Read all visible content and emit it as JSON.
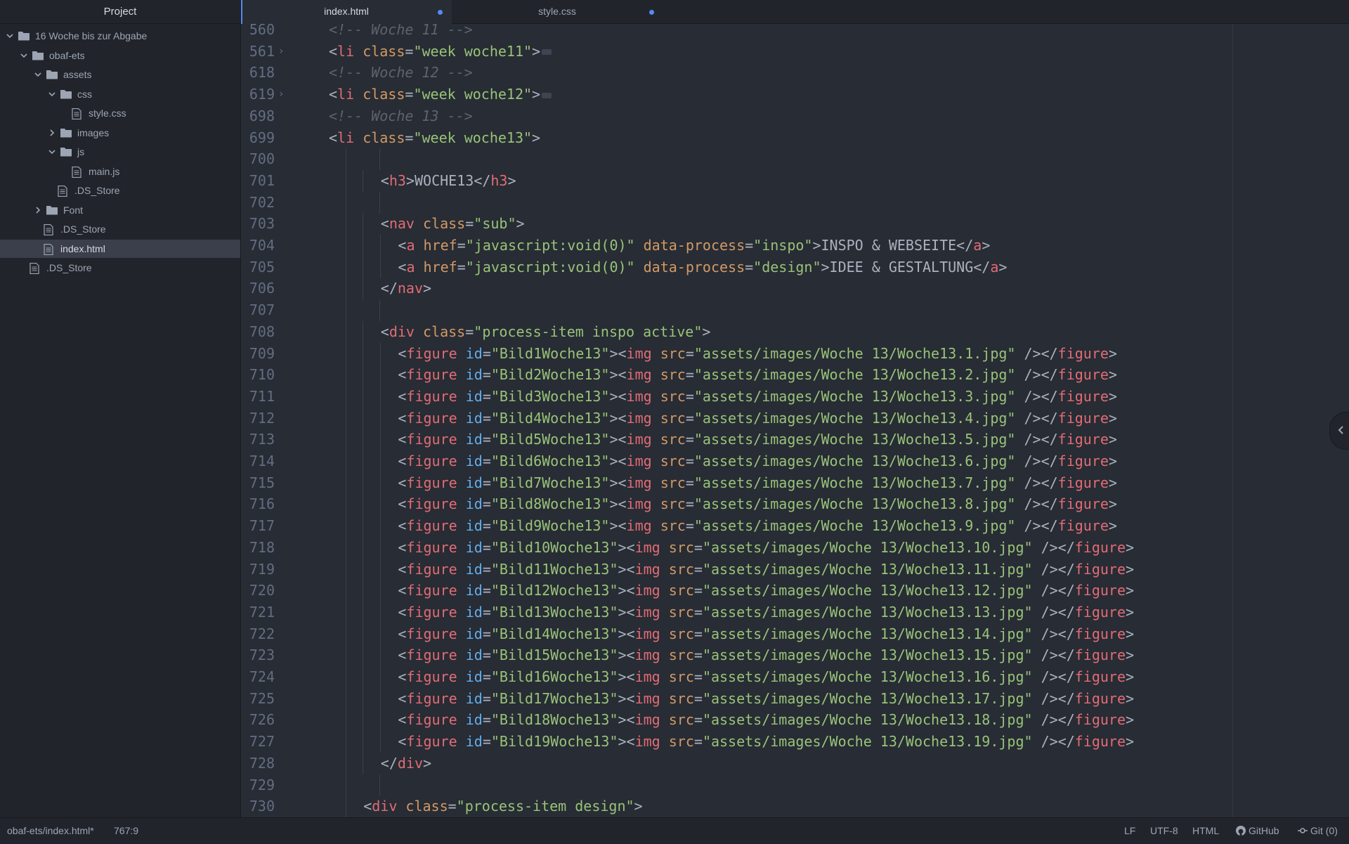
{
  "sidebar": {
    "title": "Project",
    "tree": [
      {
        "label": "16 Woche bis zur Abgabe",
        "type": "folder",
        "expanded": true,
        "depth": 0
      },
      {
        "label": "obaf-ets",
        "type": "folder",
        "expanded": true,
        "depth": 1
      },
      {
        "label": "assets",
        "type": "folder",
        "expanded": true,
        "depth": 2
      },
      {
        "label": "css",
        "type": "folder",
        "expanded": true,
        "depth": 3
      },
      {
        "label": "style.css",
        "type": "file",
        "depth": 4
      },
      {
        "label": "images",
        "type": "folder",
        "expanded": false,
        "depth": 3
      },
      {
        "label": "js",
        "type": "folder",
        "expanded": true,
        "depth": 3
      },
      {
        "label": "main.js",
        "type": "file",
        "depth": 4
      },
      {
        "label": ".DS_Store",
        "type": "file",
        "depth": 3
      },
      {
        "label": "Font",
        "type": "folder",
        "expanded": false,
        "depth": 2
      },
      {
        "label": ".DS_Store",
        "type": "file",
        "depth": 2
      },
      {
        "label": "index.html",
        "type": "file",
        "depth": 2,
        "selected": true
      },
      {
        "label": ".DS_Store",
        "type": "file",
        "depth": 1
      }
    ]
  },
  "tabs": [
    {
      "label": "index.html",
      "active": true,
      "modified": true
    },
    {
      "label": "style.css",
      "active": false,
      "modified": true
    }
  ],
  "editor": {
    "lines": [
      {
        "n": "560",
        "indent": 0,
        "segs": [
          [
            "com",
            "<!-- Woche 11 -->"
          ]
        ]
      },
      {
        "n": "561",
        "indent": 0,
        "fold": true,
        "segs": [
          [
            "punct",
            "<"
          ],
          [
            "tag",
            "li"
          ],
          [
            "punct",
            " "
          ],
          [
            "attr",
            "class"
          ],
          [
            "punct",
            "="
          ],
          [
            "str",
            "\"week woche11\""
          ],
          [
            "punct",
            ">"
          ]
        ],
        "collapsed": true
      },
      {
        "n": "618",
        "indent": 0,
        "segs": [
          [
            "com",
            "<!-- Woche 12 -->"
          ]
        ]
      },
      {
        "n": "619",
        "indent": 0,
        "fold": true,
        "segs": [
          [
            "punct",
            "<"
          ],
          [
            "tag",
            "li"
          ],
          [
            "punct",
            " "
          ],
          [
            "attr",
            "class"
          ],
          [
            "punct",
            "="
          ],
          [
            "str",
            "\"week woche12\""
          ],
          [
            "punct",
            ">"
          ]
        ],
        "collapsed": true
      },
      {
        "n": "698",
        "indent": 0,
        "segs": [
          [
            "com",
            "<!-- Woche 13 -->"
          ]
        ]
      },
      {
        "n": "699",
        "indent": 0,
        "segs": [
          [
            "punct",
            "<"
          ],
          [
            "tag",
            "li"
          ],
          [
            "punct",
            " "
          ],
          [
            "attr",
            "class"
          ],
          [
            "punct",
            "="
          ],
          [
            "str",
            "\"week woche13\""
          ],
          [
            "punct",
            ">"
          ]
        ]
      },
      {
        "n": "700",
        "indent": 0,
        "segs": []
      },
      {
        "n": "701",
        "indent": 3,
        "segs": [
          [
            "punct",
            "<"
          ],
          [
            "tag",
            "h3"
          ],
          [
            "punct",
            ">"
          ],
          [
            "text",
            "WOCHE13"
          ],
          [
            "punct",
            "</"
          ],
          [
            "tag",
            "h3"
          ],
          [
            "punct",
            ">"
          ]
        ]
      },
      {
        "n": "702",
        "indent": 0,
        "segs": []
      },
      {
        "n": "703",
        "indent": 3,
        "segs": [
          [
            "punct",
            "<"
          ],
          [
            "tag",
            "nav"
          ],
          [
            "punct",
            " "
          ],
          [
            "attr",
            "class"
          ],
          [
            "punct",
            "="
          ],
          [
            "str",
            "\"sub\""
          ],
          [
            "punct",
            ">"
          ]
        ]
      },
      {
        "n": "704",
        "indent": 4,
        "segs": [
          [
            "punct",
            "<"
          ],
          [
            "tag",
            "a"
          ],
          [
            "punct",
            " "
          ],
          [
            "attr",
            "href"
          ],
          [
            "punct",
            "="
          ],
          [
            "str",
            "\"javascript:void(0)\""
          ],
          [
            "punct",
            " "
          ],
          [
            "attr",
            "data-process"
          ],
          [
            "punct",
            "="
          ],
          [
            "str",
            "\"inspo\""
          ],
          [
            "punct",
            ">"
          ],
          [
            "text",
            "INSPO & WEBSEITE"
          ],
          [
            "punct",
            "</"
          ],
          [
            "tag",
            "a"
          ],
          [
            "punct",
            ">"
          ]
        ]
      },
      {
        "n": "705",
        "indent": 4,
        "segs": [
          [
            "punct",
            "<"
          ],
          [
            "tag",
            "a"
          ],
          [
            "punct",
            " "
          ],
          [
            "attr",
            "href"
          ],
          [
            "punct",
            "="
          ],
          [
            "str",
            "\"javascript:void(0)\""
          ],
          [
            "punct",
            " "
          ],
          [
            "attr",
            "data-process"
          ],
          [
            "punct",
            "="
          ],
          [
            "str",
            "\"design\""
          ],
          [
            "punct",
            ">"
          ],
          [
            "text",
            "IDEE & GESTALTUNG"
          ],
          [
            "punct",
            "</"
          ],
          [
            "tag",
            "a"
          ],
          [
            "punct",
            ">"
          ]
        ]
      },
      {
        "n": "706",
        "indent": 3,
        "segs": [
          [
            "punct",
            "</"
          ],
          [
            "tag",
            "nav"
          ],
          [
            "punct",
            ">"
          ]
        ]
      },
      {
        "n": "707",
        "indent": 0,
        "segs": []
      },
      {
        "n": "708",
        "indent": 3,
        "segs": [
          [
            "punct",
            "<"
          ],
          [
            "tag",
            "div"
          ],
          [
            "punct",
            " "
          ],
          [
            "attr",
            "class"
          ],
          [
            "punct",
            "="
          ],
          [
            "str",
            "\"process-item inspo active\""
          ],
          [
            "punct",
            ">"
          ]
        ]
      },
      {
        "n": "709",
        "indent": 4,
        "fig": "1"
      },
      {
        "n": "710",
        "indent": 4,
        "fig": "2"
      },
      {
        "n": "711",
        "indent": 4,
        "fig": "3"
      },
      {
        "n": "712",
        "indent": 4,
        "fig": "4"
      },
      {
        "n": "713",
        "indent": 4,
        "fig": "5"
      },
      {
        "n": "714",
        "indent": 4,
        "fig": "6"
      },
      {
        "n": "715",
        "indent": 4,
        "fig": "7"
      },
      {
        "n": "716",
        "indent": 4,
        "fig": "8"
      },
      {
        "n": "717",
        "indent": 4,
        "fig": "9"
      },
      {
        "n": "718",
        "indent": 4,
        "fig": "10"
      },
      {
        "n": "719",
        "indent": 4,
        "fig": "11"
      },
      {
        "n": "720",
        "indent": 4,
        "fig": "12"
      },
      {
        "n": "721",
        "indent": 4,
        "fig": "13"
      },
      {
        "n": "722",
        "indent": 4,
        "fig": "14"
      },
      {
        "n": "723",
        "indent": 4,
        "fig": "15"
      },
      {
        "n": "724",
        "indent": 4,
        "fig": "16"
      },
      {
        "n": "725",
        "indent": 4,
        "fig": "17"
      },
      {
        "n": "726",
        "indent": 4,
        "fig": "18"
      },
      {
        "n": "727",
        "indent": 4,
        "fig": "19"
      },
      {
        "n": "728",
        "indent": 3,
        "segs": [
          [
            "punct",
            "</"
          ],
          [
            "tag",
            "div"
          ],
          [
            "punct",
            ">"
          ]
        ]
      },
      {
        "n": "729",
        "indent": 0,
        "segs": []
      },
      {
        "n": "730",
        "indent": 2,
        "segs": [
          [
            "punct",
            "<"
          ],
          [
            "tag",
            "div"
          ],
          [
            "punct",
            " "
          ],
          [
            "attr",
            "class"
          ],
          [
            "punct",
            "="
          ],
          [
            "str",
            "\"process-item design\""
          ],
          [
            "punct",
            ">"
          ]
        ]
      }
    ]
  },
  "statusbar": {
    "file_path": "obaf-ets/index.html*",
    "cursor": "767:9",
    "line_ending": "LF",
    "encoding": "UTF-8",
    "grammar": "HTML",
    "github": "GitHub",
    "git": "Git (0)"
  },
  "colors": {
    "accent": "#568af2",
    "tag": "#e06c75",
    "attribute": "#d19a66",
    "id_attribute": "#61afef",
    "string": "#98c379",
    "comment": "#5c6370"
  }
}
